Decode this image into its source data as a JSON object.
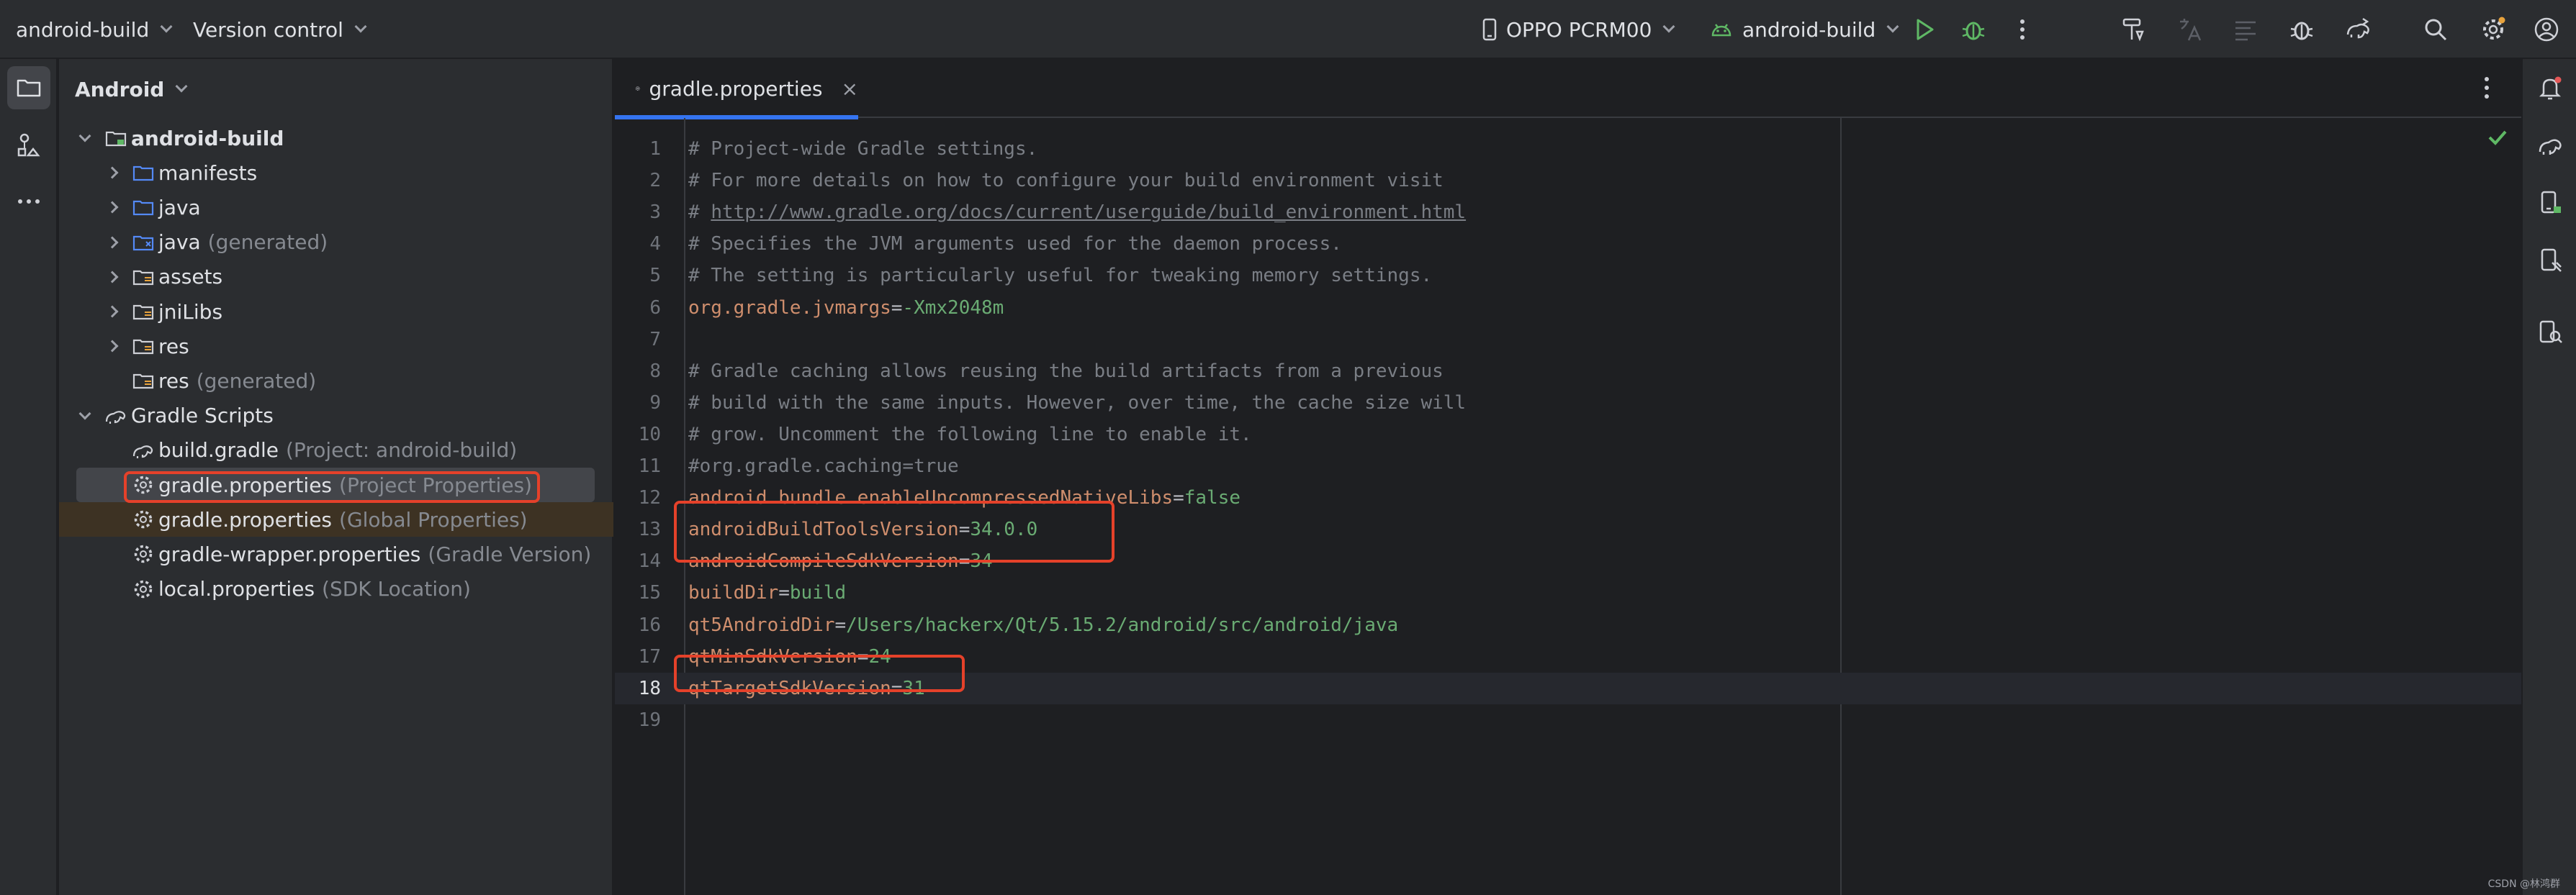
{
  "titlebar": {
    "project_name": "android-build",
    "vcs_label": "Version control",
    "device_label": "OPPO PCRM00",
    "run_config_label": "android-build"
  },
  "left_strip": {
    "icons": [
      "folder-icon",
      "structure-icon",
      "more-icon"
    ]
  },
  "project_panel": {
    "view_label": "Android",
    "tree": [
      {
        "label": "android-build",
        "hint": "",
        "icon": "module-icon",
        "arrow": "down",
        "indent": 0,
        "bold": true
      },
      {
        "label": "manifests",
        "hint": "",
        "icon": "folder-icon",
        "arrow": "right",
        "indent": 1,
        "bold": false
      },
      {
        "label": "java",
        "hint": "",
        "icon": "folder-icon",
        "arrow": "right",
        "indent": 1,
        "bold": false
      },
      {
        "label": "java",
        "hint": "(generated)",
        "icon": "folder-generated-icon",
        "arrow": "right",
        "indent": 1,
        "bold": false
      },
      {
        "label": "assets",
        "hint": "",
        "icon": "resource-folder-icon",
        "arrow": "right",
        "indent": 1,
        "bold": false
      },
      {
        "label": "jniLibs",
        "hint": "",
        "icon": "resource-folder-icon",
        "arrow": "right",
        "indent": 1,
        "bold": false
      },
      {
        "label": "res",
        "hint": "",
        "icon": "resource-folder-icon",
        "arrow": "right",
        "indent": 1,
        "bold": false
      },
      {
        "label": "res",
        "hint": "(generated)",
        "icon": "resource-folder-icon",
        "arrow": "none",
        "indent": 1,
        "bold": false
      },
      {
        "label": "Gradle Scripts",
        "hint": "",
        "icon": "gradle-icon",
        "arrow": "down",
        "indent": 0,
        "bold": false
      },
      {
        "label": "build.gradle",
        "hint": "(Project: android-build)",
        "icon": "gradle-icon",
        "arrow": "none",
        "indent": 1,
        "bold": false
      },
      {
        "label": "gradle.properties",
        "hint": "(Project Properties)",
        "icon": "gear-icon",
        "arrow": "none",
        "indent": 1,
        "bold": false,
        "selected": true
      },
      {
        "label": "gradle.properties",
        "hint": "(Global Properties)",
        "icon": "gear-icon",
        "arrow": "none",
        "indent": 1,
        "bold": false,
        "alt": true
      },
      {
        "label": "gradle-wrapper.properties",
        "hint": "(Gradle Version)",
        "icon": "gear-icon",
        "arrow": "none",
        "indent": 1,
        "bold": false
      },
      {
        "label": "local.properties",
        "hint": "(SDK Location)",
        "icon": "gear-icon",
        "arrow": "none",
        "indent": 1,
        "bold": false
      }
    ]
  },
  "editor": {
    "tab_label": "gradle.properties",
    "tab_close": "×",
    "current_line": 18,
    "lines": [
      {
        "n": "1",
        "parts": [
          {
            "t": "# Project-wide Gradle settings.",
            "c": "c-comment"
          }
        ]
      },
      {
        "n": "2",
        "parts": [
          {
            "t": "# For more details on how to configure your build environment visit",
            "c": "c-comment"
          }
        ]
      },
      {
        "n": "3",
        "parts": [
          {
            "t": "# ",
            "c": "c-comment"
          },
          {
            "t": "http://www.gradle.org/docs/current/userguide/build_environment.html",
            "c": "c-link"
          }
        ]
      },
      {
        "n": "4",
        "parts": [
          {
            "t": "# Specifies the JVM arguments used for the daemon process.",
            "c": "c-comment"
          }
        ]
      },
      {
        "n": "5",
        "parts": [
          {
            "t": "# The setting is particularly useful for tweaking memory settings.",
            "c": "c-comment"
          }
        ]
      },
      {
        "n": "6",
        "parts": [
          {
            "t": "org.gradle.jvmargs",
            "c": "c-key"
          },
          {
            "t": "=",
            "c": "c-eq"
          },
          {
            "t": "-Xmx2048m",
            "c": "c-val"
          }
        ]
      },
      {
        "n": "7",
        "parts": []
      },
      {
        "n": "8",
        "parts": [
          {
            "t": "# Gradle caching allows reusing the build artifacts from a previous",
            "c": "c-comment"
          }
        ]
      },
      {
        "n": "9",
        "parts": [
          {
            "t": "# build with the same inputs. However, over time, the cache size will",
            "c": "c-comment"
          }
        ]
      },
      {
        "n": "10",
        "parts": [
          {
            "t": "# grow. Uncomment the following line to enable it.",
            "c": "c-comment"
          }
        ]
      },
      {
        "n": "11",
        "parts": [
          {
            "t": "#org.gradle.caching=true",
            "c": "c-comment"
          }
        ]
      },
      {
        "n": "12",
        "parts": [
          {
            "t": "android.bundle.enableUncompressedNativeLibs",
            "c": "c-key"
          },
          {
            "t": "=",
            "c": "c-eq"
          },
          {
            "t": "false",
            "c": "c-val"
          }
        ]
      },
      {
        "n": "13",
        "parts": [
          {
            "t": "androidBuildToolsVersion",
            "c": "c-key"
          },
          {
            "t": "=",
            "c": "c-eq"
          },
          {
            "t": "34.0.0",
            "c": "c-val"
          }
        ]
      },
      {
        "n": "14",
        "parts": [
          {
            "t": "androidCompileSdkVersion",
            "c": "c-key"
          },
          {
            "t": "=",
            "c": "c-eq"
          },
          {
            "t": "34",
            "c": "c-val"
          }
        ]
      },
      {
        "n": "15",
        "parts": [
          {
            "t": "buildDir",
            "c": "c-key"
          },
          {
            "t": "=",
            "c": "c-eq"
          },
          {
            "t": "build",
            "c": "c-val"
          }
        ]
      },
      {
        "n": "16",
        "parts": [
          {
            "t": "qt5AndroidDir",
            "c": "c-key"
          },
          {
            "t": "=",
            "c": "c-eq"
          },
          {
            "t": "/Users/hackerx/Qt/5.15.2/android/src/android/java",
            "c": "c-val"
          }
        ]
      },
      {
        "n": "17",
        "parts": [
          {
            "t": "qtMinSdkVersion",
            "c": "c-key"
          },
          {
            "t": "=",
            "c": "c-eq"
          },
          {
            "t": "24",
            "c": "c-val"
          }
        ]
      },
      {
        "n": "18",
        "parts": [
          {
            "t": "qtTargetSdkVersion",
            "c": "c-key"
          },
          {
            "t": "=",
            "c": "c-eq"
          },
          {
            "t": "31",
            "c": "c-val"
          }
        ]
      },
      {
        "n": "19",
        "parts": []
      }
    ]
  },
  "watermark": "CSDN @林鸿群",
  "colors": {
    "accent": "#3574f0",
    "highlight": "#e5412a",
    "key": "#cf8e6d",
    "value": "#6aab73",
    "comment": "#7a7e85"
  }
}
